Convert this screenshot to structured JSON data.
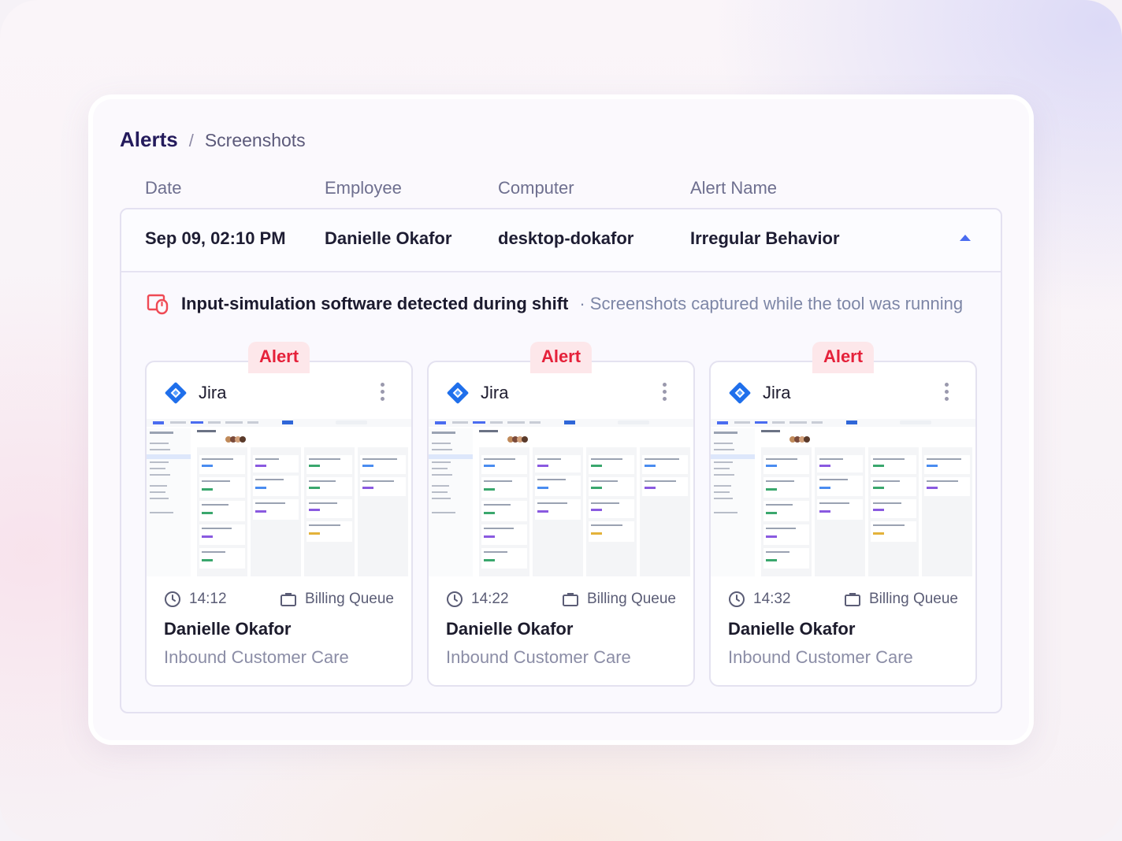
{
  "breadcrumb": {
    "section": "Alerts",
    "separator": "/",
    "page": "Screenshots"
  },
  "columns": [
    "Date",
    "Employee",
    "Computer",
    "Alert Name"
  ],
  "alert_row": {
    "date": "Sep 09, 02:10 PM",
    "employee": "Danielle Okafor",
    "computer": "desktop-dokafor",
    "alert_name": "Irregular Behavior"
  },
  "detail": {
    "title": "Input-simulation software detected during shift",
    "subtitle": "· Screenshots captured while the tool was running"
  },
  "colors": {
    "accent": "#4a6cf0",
    "alert_red": "#e5213a",
    "jira_blue": "#1f6feb"
  },
  "screenshots": [
    {
      "badge": "Alert",
      "app": "Jira",
      "app_icon": "jira-logo-icon",
      "time": "14:12",
      "queue": "Billing Queue",
      "employee": "Danielle Okafor",
      "team": "Inbound Customer Care"
    },
    {
      "badge": "Alert",
      "app": "Jira",
      "app_icon": "jira-logo-icon",
      "time": "14:22",
      "queue": "Billing Queue",
      "employee": "Danielle Okafor",
      "team": "Inbound Customer Care"
    },
    {
      "badge": "Alert",
      "app": "Jira",
      "app_icon": "jira-logo-icon",
      "time": "14:32",
      "queue": "Billing Queue",
      "employee": "Danielle Okafor",
      "team": "Inbound Customer Care"
    }
  ]
}
